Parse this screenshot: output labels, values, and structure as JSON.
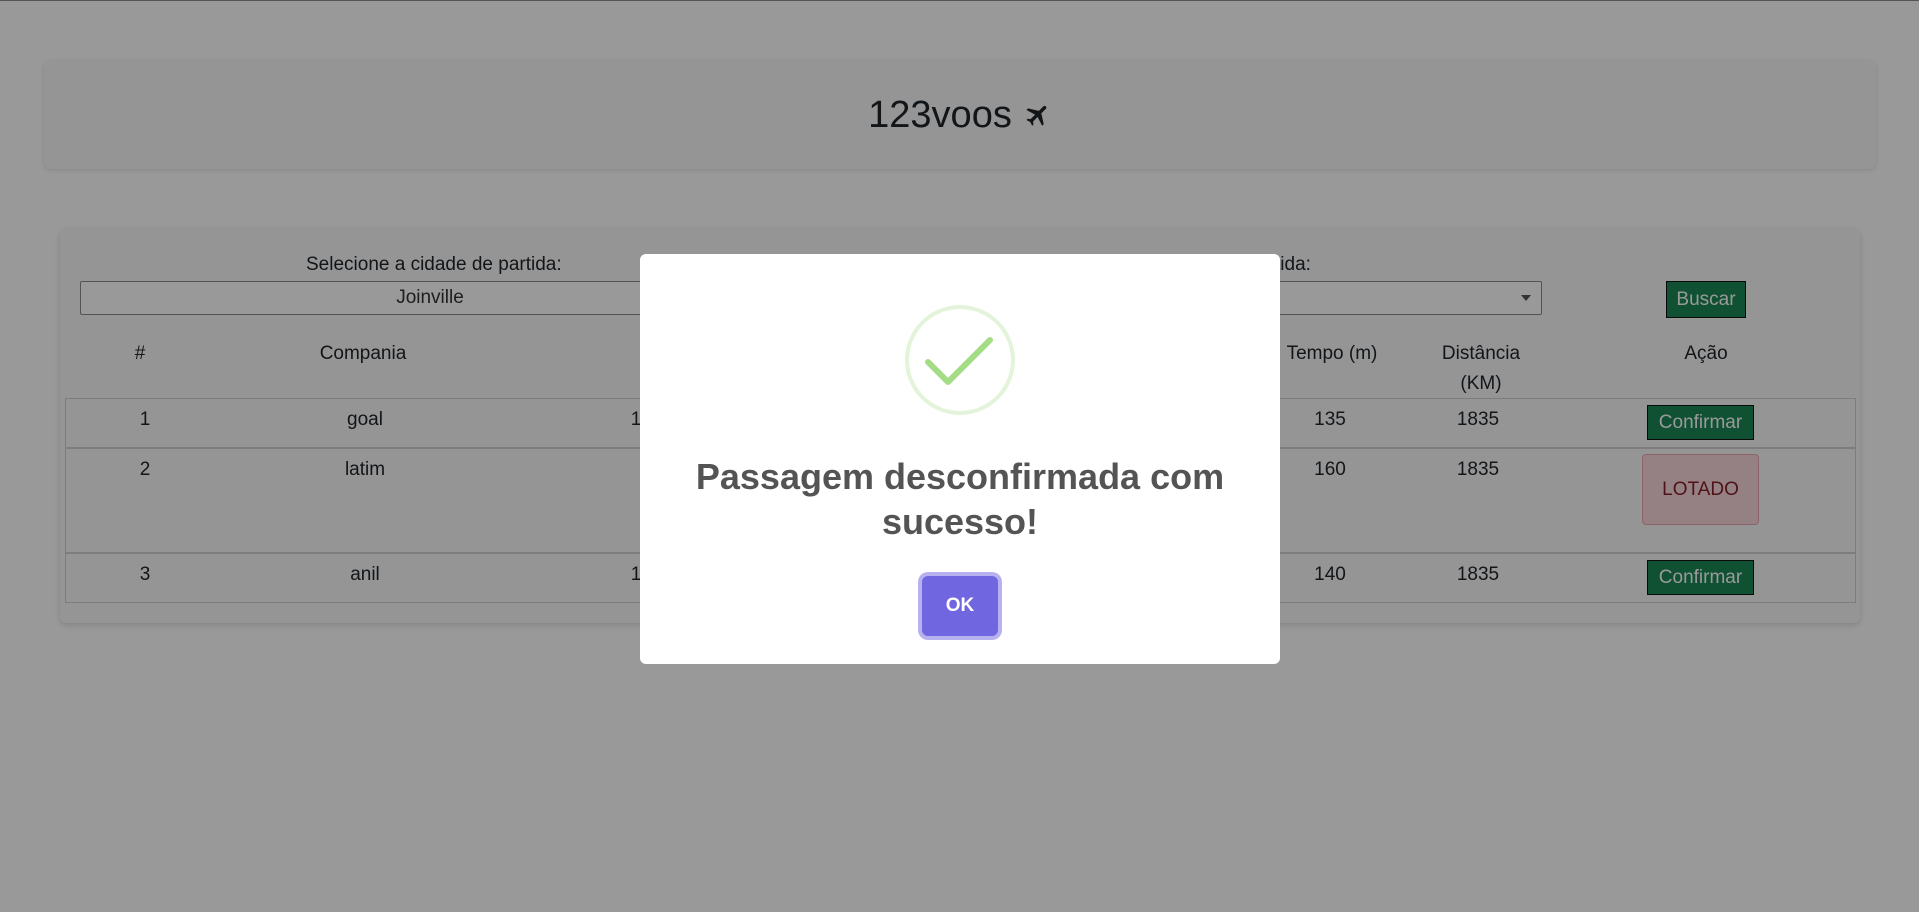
{
  "header": {
    "brand": "123voos"
  },
  "search": {
    "origin_label": "Selecione a cidade de partida:",
    "origin_value": "Joinville",
    "destination_label_partial": "tida:",
    "search_button": "Buscar"
  },
  "table": {
    "headers": {
      "index": "#",
      "company": "Compania",
      "time": "Tempo (m)",
      "distance_line1": "Distância",
      "distance_line2": "(KM)",
      "action": "Ação"
    },
    "rows": [
      {
        "index": "1",
        "company": "goal",
        "partial": "1",
        "time": "135",
        "distance": "1835",
        "action": "Confirmar"
      },
      {
        "index": "2",
        "company": "latim",
        "partial": "",
        "time": "160",
        "distance": "1835",
        "action": "LOTADO"
      },
      {
        "index": "3",
        "company": "anil",
        "partial": "1",
        "time": "140",
        "distance": "1835",
        "action": "Confirmar"
      }
    ]
  },
  "modal": {
    "title": "Passagem desconfirmada com sucesso!",
    "ok_button": "OK"
  },
  "colors": {
    "accent_green": "#198754",
    "ok_purple": "#7066e0",
    "success_check": "#a5dc86"
  }
}
